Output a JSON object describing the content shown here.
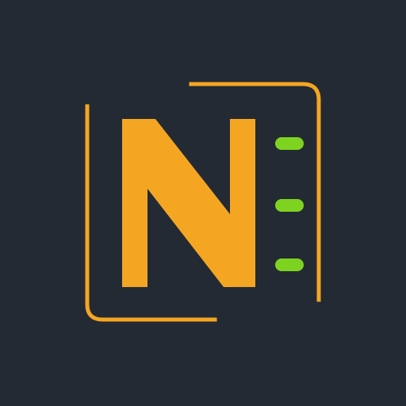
{
  "logo": {
    "letter": "N",
    "colors": {
      "background": "#232a33",
      "accent": "#f4a623",
      "dots": "#7ed321"
    },
    "icon_name": "film-strip-n-logo-icon"
  }
}
